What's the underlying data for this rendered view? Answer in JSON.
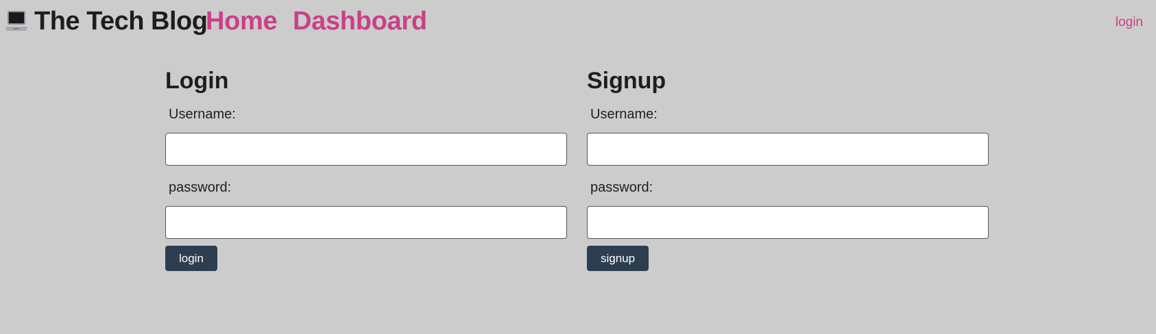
{
  "header": {
    "brand_icon": "laptop-icon",
    "title": "The Tech Blog",
    "nav": {
      "home_label": "Home",
      "dashboard_label": "Dashboard"
    },
    "login_label": "login",
    "link_color": "#cc3f88"
  },
  "login_form": {
    "heading": "Login",
    "username_label": "Username:",
    "username_value": "",
    "password_label": "password:",
    "password_value": "",
    "submit_label": "login"
  },
  "signup_form": {
    "heading": "Signup",
    "username_label": "Username:",
    "username_value": "",
    "password_label": "password:",
    "password_value": "",
    "submit_label": "signup"
  },
  "colors": {
    "background": "#cccccc",
    "button": "#2c3e50"
  }
}
